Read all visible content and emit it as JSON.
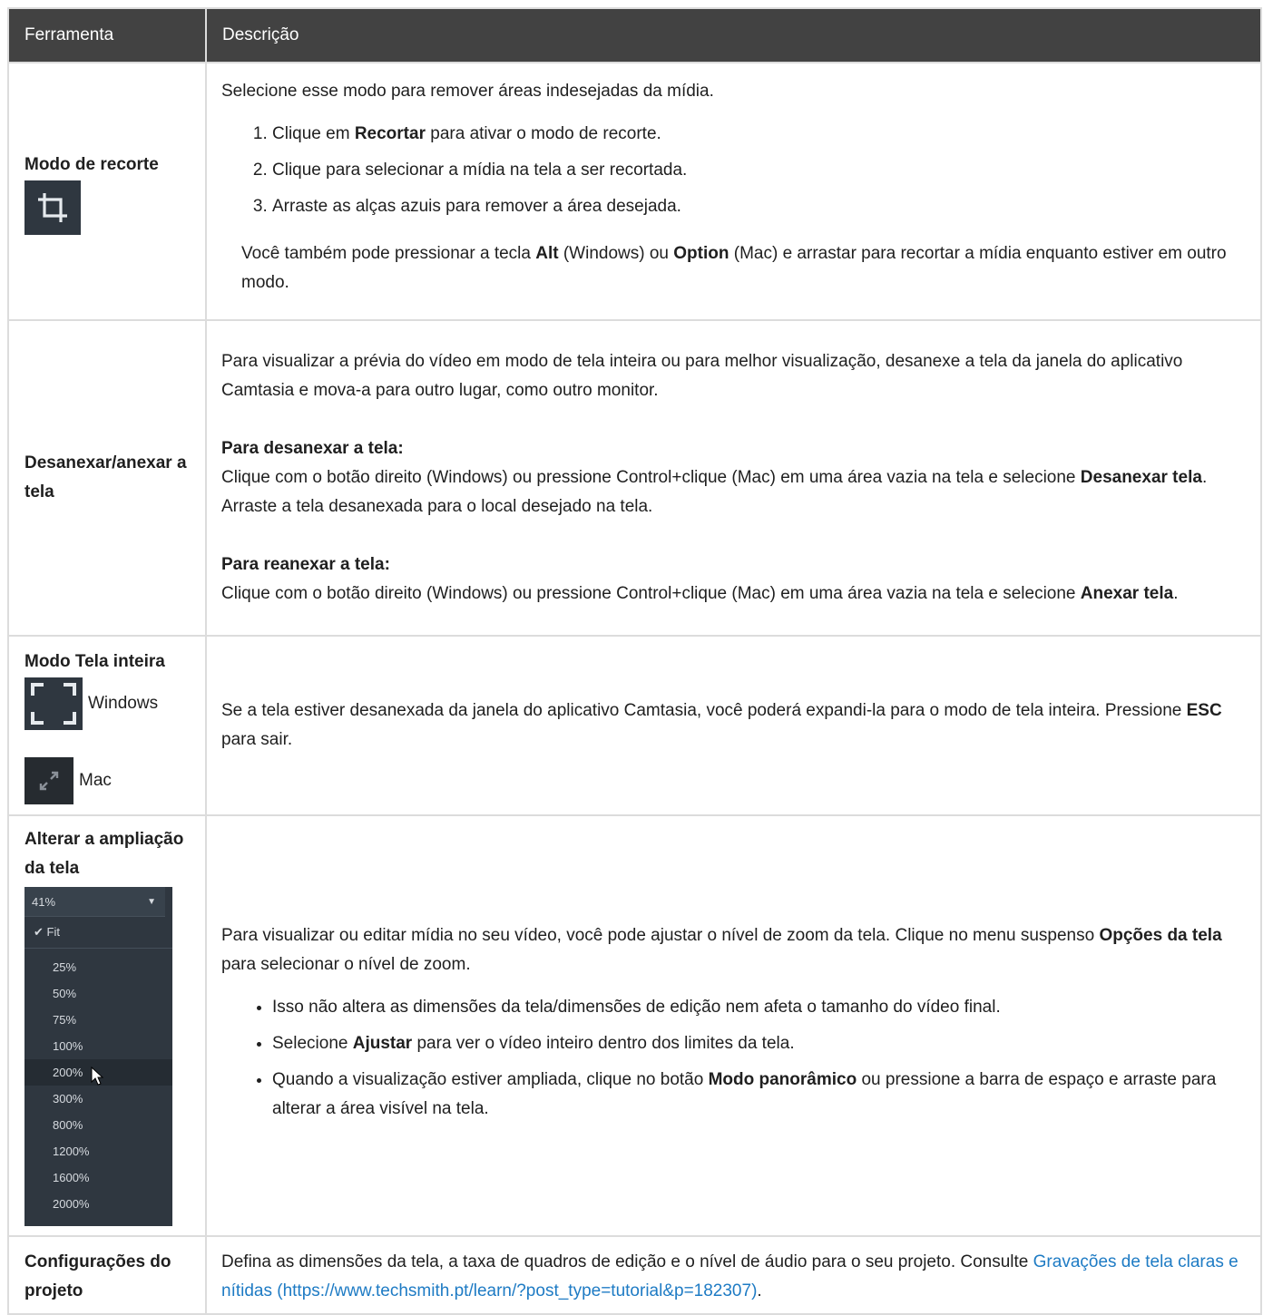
{
  "table": {
    "headers": [
      "Ferramenta",
      "Descrição"
    ]
  },
  "rows": {
    "crop": {
      "tool": "Modo de recorte",
      "intro": "Selecione esse modo para remover áreas indesejadas da mídia.",
      "steps": [
        {
          "pre": "Clique em ",
          "bold": "Recortar",
          "post": " para ativar o modo de recorte."
        },
        {
          "text": "Clique para selecionar a mídia na tela a ser recortada."
        },
        {
          "text": "Arraste as alças azuis para remover a área desejada."
        }
      ],
      "note": {
        "p1": "Você também pode pressionar a tecla ",
        "b1": "Alt",
        "p2": " (Windows) ou ",
        "b2": "Option",
        "p3": " (Mac) e arrastar para recortar a mídia enquanto estiver em outro modo."
      }
    },
    "detach": {
      "tool": "Desanexar/anexar a tela",
      "intro": "Para visualizar a prévia do vídeo em modo de tela inteira ou para melhor visualização, desanexe a tela da janela do aplicativo Camtasia e mova-a para outro lugar, como outro monitor.",
      "h1": "Para desanexar a tela:",
      "t1": "Clique com o botão direito (Windows) ou pressione Control+clique (Mac) em uma área vazia na tela e selecione ",
      "b1": "Desanexar tela",
      "t1b": ". Arraste a tela desanexada para o local desejado na tela.",
      "h2": "Para reanexar a tela:",
      "t2": "Clique com o botão direito (Windows) ou pressione Control+clique (Mac) em uma área vazia na tela e selecione ",
      "b2": "Anexar tela",
      "t2b": "."
    },
    "fullscreen": {
      "tool": "Modo Tela inteira",
      "windows_label": "Windows",
      "mac_label": "Mac",
      "d1": "Se a tela estiver desanexada da janela do aplicativo Camtasia, você poderá expandi-la para o modo de tela inteira. Pressione ",
      "b": "ESC",
      "d2": " para sair."
    },
    "zoom": {
      "tool": "Alterar a ampliação da tela",
      "menu": {
        "current": "41%",
        "fit": "Fit",
        "options": [
          "25%",
          "50%",
          "75%",
          "100%",
          "200%",
          "300%",
          "800%",
          "1200%",
          "1600%",
          "2000%"
        ],
        "hovered": "200%"
      },
      "d1": "Para visualizar ou editar mídia no seu vídeo, você pode ajustar o nível de zoom da tela. Clique no menu suspenso ",
      "b1": "Opções da tela",
      "d2": " para selecionar o nível de zoom.",
      "bullets": [
        {
          "text": "Isso não altera as dimensões da tela/dimensões de edição nem afeta o tamanho do vídeo final."
        },
        {
          "pre": "Selecione ",
          "bold": "Ajustar",
          "post": " para ver o vídeo inteiro dentro dos limites da tela."
        },
        {
          "pre": "Quando a visualização estiver ampliada, clique no botão ",
          "bold": "Modo panorâmico",
          "post": " ou pressione a barra de espaço e arraste para alterar a área visível na tela."
        }
      ]
    },
    "project": {
      "tool": "Configurações do projeto",
      "d1": "Defina as dimensões da tela, a taxa de quadros de edição e o nível de áudio para o seu projeto. Consulte ",
      "link": "Gravações de tela claras e nítidas (https://www.techsmith.pt/learn/?post_type=tutorial&p=182307)",
      "d2": "."
    }
  }
}
